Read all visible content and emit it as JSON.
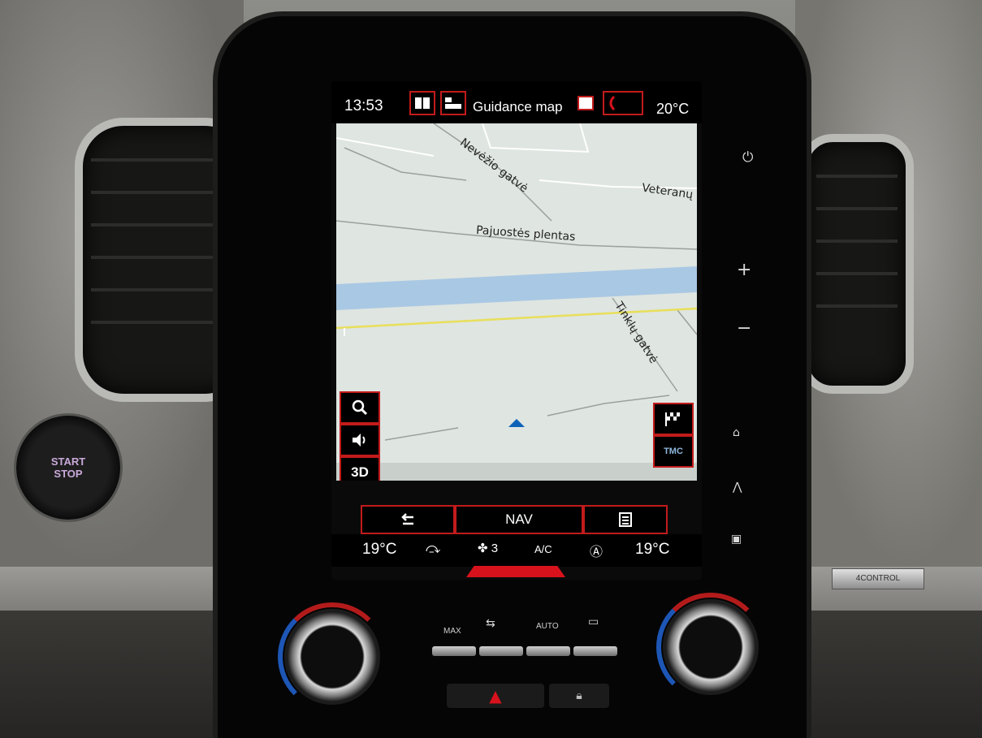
{
  "status_bar": {
    "time": "13:53",
    "title": "Guidance map",
    "outside_temp": "20°C",
    "left_icons": [
      "map-book-icon",
      "map-layers-icon"
    ],
    "right_icons": [
      "info-card-icon",
      "phone-icon"
    ]
  },
  "map": {
    "street_labels": [
      "Nevėžio gatvė",
      "Veteranų",
      "Pajuostės plentas",
      "Tinklų gatvė"
    ],
    "colors": {
      "land": "#dfe5e1",
      "river": "#a9c8e3",
      "road_main": "#e8df5a",
      "cursor": "#0e63b8"
    }
  },
  "side_controls": {
    "search_icon": "search-icon",
    "volume_icon": "volume-icon",
    "view_label": "3D",
    "destination_icon": "checkered-flag-icon",
    "traffic_label": "TMC"
  },
  "bottom_bar": {
    "back_icon": "back-arrow-icon",
    "nav_label": "NAV",
    "menu_icon": "menu-list-icon"
  },
  "climate": {
    "left_temp": "19°C",
    "fan_level": "3",
    "ac_label": "A/C",
    "right_temp": "19°C"
  },
  "hardware": {
    "start_stop": [
      "START",
      "STOP"
    ],
    "auto_label": "AUTO",
    "max_label": "MAX",
    "accent_red": "#c21b1b"
  }
}
